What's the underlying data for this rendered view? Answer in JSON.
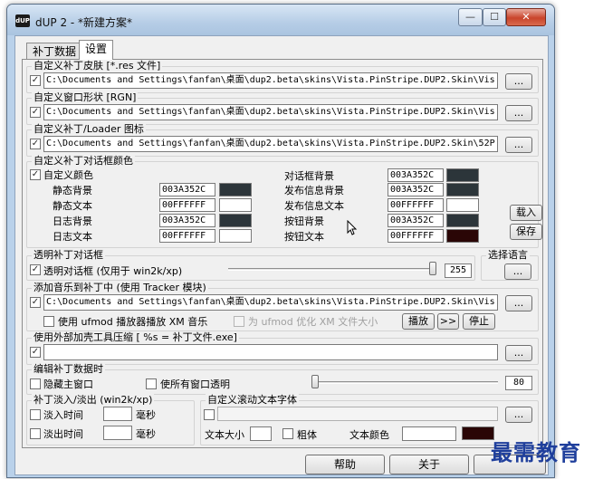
{
  "window": {
    "title": "dUP 2 - *新建方案*",
    "icon_text": "dUP",
    "min": "—",
    "max": "☐",
    "close": "✕"
  },
  "tabs": [
    {
      "label": "补丁数据"
    },
    {
      "label": "设置"
    }
  ],
  "skin": {
    "title": "自定义补丁皮肤 [*.res 文件]",
    "path": "C:\\Documents and Settings\\fanfan\\桌面\\dup2.beta\\skins\\Vista.PinStripe.DUP2.Skin\\Vis",
    "browse": "..."
  },
  "shape": {
    "title": "自定义窗口形状 [RGN]",
    "path": "C:\\Documents and Settings\\fanfan\\桌面\\dup2.beta\\skins\\Vista.PinStripe.DUP2.Skin\\Vis",
    "browse": "..."
  },
  "icon": {
    "title": "自定义补丁/Loader 图标",
    "path": "C:\\Documents and Settings\\fanfan\\桌面\\dup2.beta\\skins\\Vista.PinStripe.DUP2.Skin\\52P",
    "browse": "..."
  },
  "colors": {
    "title": "自定义补丁对话框颜色",
    "custom_label": "自定义颜色",
    "left": [
      {
        "label": "静态背景",
        "hex": "003A352C",
        "swatch": "#2c353a"
      },
      {
        "label": "静态文本",
        "hex": "00FFFFFF",
        "swatch": "#ffffff"
      },
      {
        "label": "日志背景",
        "hex": "003A352C",
        "swatch": "#2c353a"
      },
      {
        "label": "日志文本",
        "hex": "00FFFFFF",
        "swatch": "#ffffff"
      }
    ],
    "right": [
      {
        "label": "对话框背景",
        "hex": "003A352C",
        "swatch": "#2c353a"
      },
      {
        "label": "发布信息背景",
        "hex": "003A352C",
        "swatch": "#2c353a"
      },
      {
        "label": "发布信息文本",
        "hex": "00FFFFFF",
        "swatch": "#ffffff"
      },
      {
        "label": "按钮背景",
        "hex": "003A352C",
        "swatch": "#2c353a"
      },
      {
        "label": "按钮文本",
        "hex": "00FFFFFF",
        "swatch": "#2a0606"
      }
    ],
    "load": "载入",
    "save": "保存"
  },
  "transparent": {
    "title": "透明补丁对话框",
    "label": "透明对话框 (仅用于 win2k/xp)",
    "value": "255",
    "level": 1.0
  },
  "language": {
    "title": "选择语言",
    "browse": "..."
  },
  "music": {
    "title": "添加音乐到补丁中 (使用 Tracker 模块)",
    "path": "C:\\Documents and Settings\\fanfan\\桌面\\dup2.beta\\skins\\Vista.PinStripe.DUP2.Skin\\Vis",
    "browse": "...",
    "ufmod_label": "使用 ufmod 播放器播放 XM 音乐",
    "optimize_label": "为 ufmod 优化 XM 文件大小",
    "play": "播放",
    "next": ">>",
    "stop": "停止"
  },
  "packer": {
    "title": "使用外部加壳工具压缩 [ %s = 补丁文件.exe]",
    "path": "",
    "browse": "..."
  },
  "editing": {
    "title": "编辑补丁数据时",
    "hide_label": "隐藏主窗口",
    "transparent_label": "使所有窗口透明",
    "value": "80",
    "level": 0.0
  },
  "fade": {
    "title": "补丁淡入/淡出 (win2k/xp)",
    "fade_in": "淡入时间",
    "fade_out": "淡出时间",
    "unit": "毫秒"
  },
  "scroll_font": {
    "title": "自定义滚动文本字体",
    "browse": "...",
    "size_label": "文本大小",
    "bold_label": "粗体",
    "color_label": "文本颜色",
    "color_swatch": "#2a0606"
  },
  "footer": {
    "help": "帮助",
    "about": "关于"
  },
  "watermark": "最需教育"
}
